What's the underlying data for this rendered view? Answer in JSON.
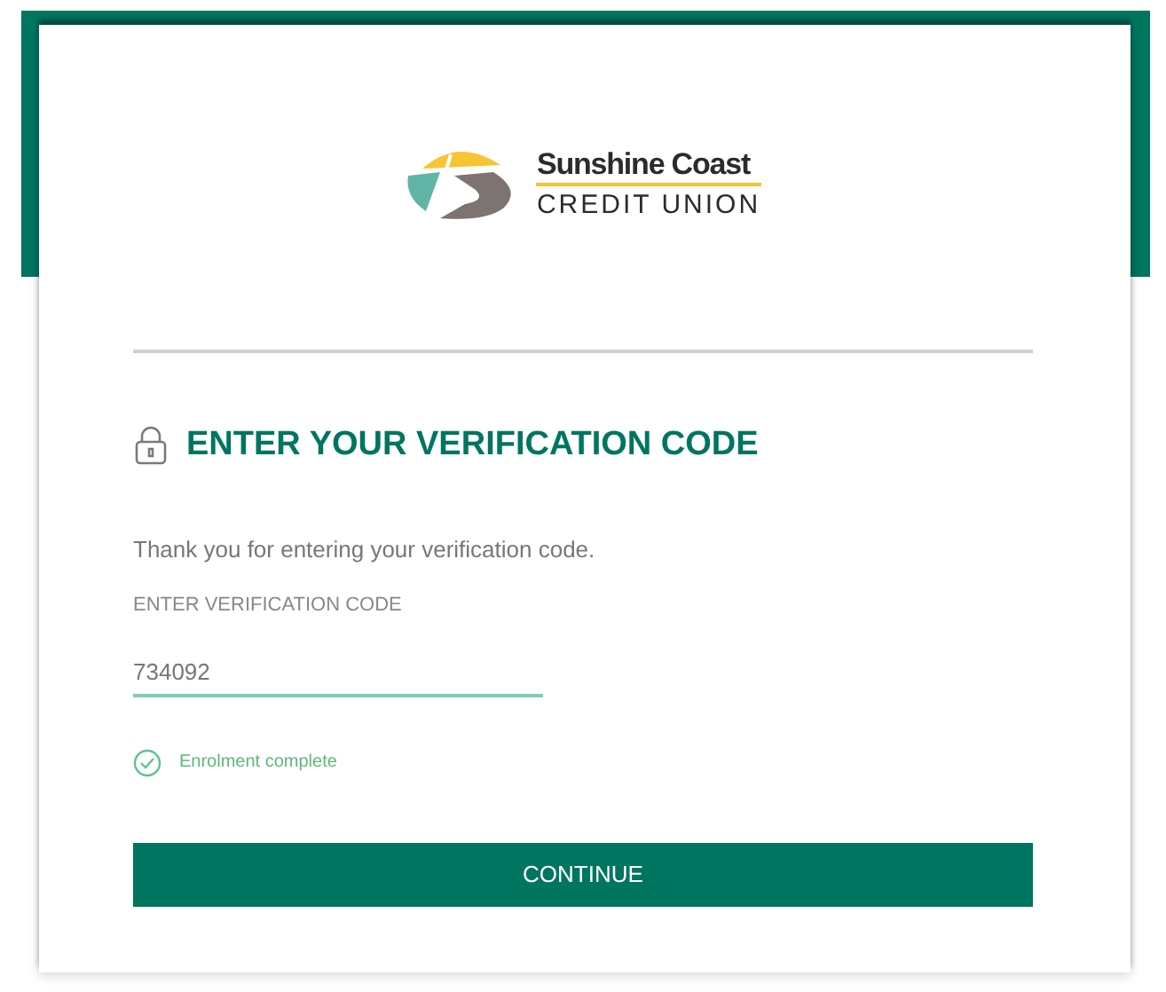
{
  "logo": {
    "line_1": "Sunshine Coast",
    "line_2": "CREDIT UNION"
  },
  "heading": "ENTER YOUR VERIFICATION CODE",
  "message": "Thank you for entering your verification code.",
  "code_field": {
    "label": "ENTER VERIFICATION CODE",
    "value": "734092"
  },
  "status": {
    "text": "Enrolment complete",
    "success": true
  },
  "buttons": [
    "CONTINUE"
  ]
}
